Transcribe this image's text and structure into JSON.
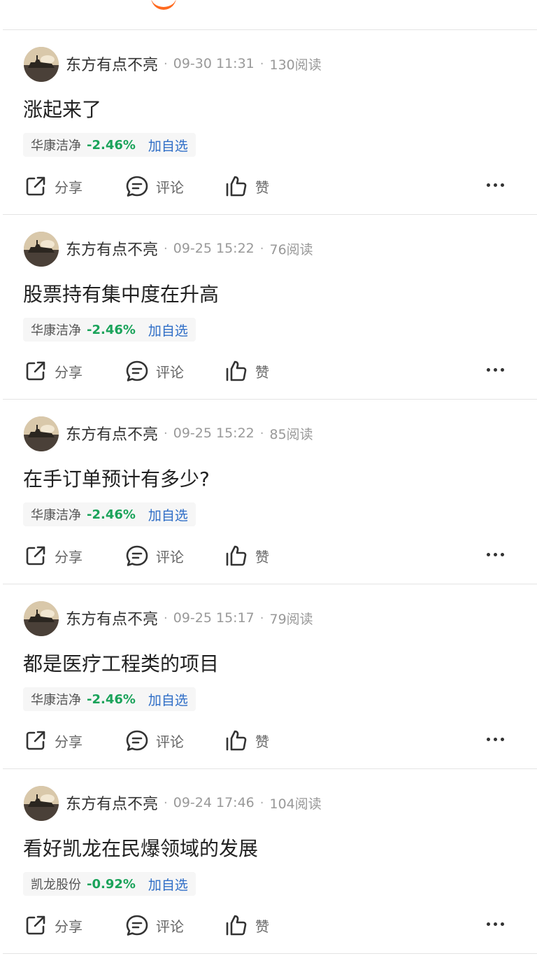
{
  "feed": {
    "posts": [
      {
        "author": "东方有点不亮",
        "time": "09-30 11:31",
        "reads": "130阅读",
        "text": "涨起来了",
        "stock": "华康洁净",
        "change": "-2.46%",
        "add": "加自选",
        "share": "分享",
        "comment": "评论",
        "like": "赞"
      },
      {
        "author": "东方有点不亮",
        "time": "09-25 15:22",
        "reads": "76阅读",
        "text": "股票持有集中度在升高",
        "stock": "华康洁净",
        "change": "-2.46%",
        "add": "加自选",
        "share": "分享",
        "comment": "评论",
        "like": "赞"
      },
      {
        "author": "东方有点不亮",
        "time": "09-25 15:22",
        "reads": "85阅读",
        "text": "在手订单预计有多少?",
        "stock": "华康洁净",
        "change": "-2.46%",
        "add": "加自选",
        "share": "分享",
        "comment": "评论",
        "like": "赞"
      },
      {
        "author": "东方有点不亮",
        "time": "09-25 15:17",
        "reads": "79阅读",
        "text": "都是医疗工程类的项目",
        "stock": "华康洁净",
        "change": "-2.46%",
        "add": "加自选",
        "share": "分享",
        "comment": "评论",
        "like": "赞"
      },
      {
        "author": "东方有点不亮",
        "time": "09-24 17:46",
        "reads": "104阅读",
        "text": "看好凯龙在民爆领域的发展",
        "stock": "凯龙股份",
        "change": "-0.92%",
        "add": "加自选",
        "share": "分享",
        "comment": "评论",
        "like": "赞"
      }
    ]
  },
  "colors": {
    "accent": "#ff6a1f",
    "down": "#1aa35a",
    "link": "#2f6ec7",
    "divider": "#e4e4e4"
  },
  "icons": {
    "share": "share-icon",
    "comment": "comment-icon",
    "like": "thumbs-up-icon",
    "more": "more-icon"
  }
}
